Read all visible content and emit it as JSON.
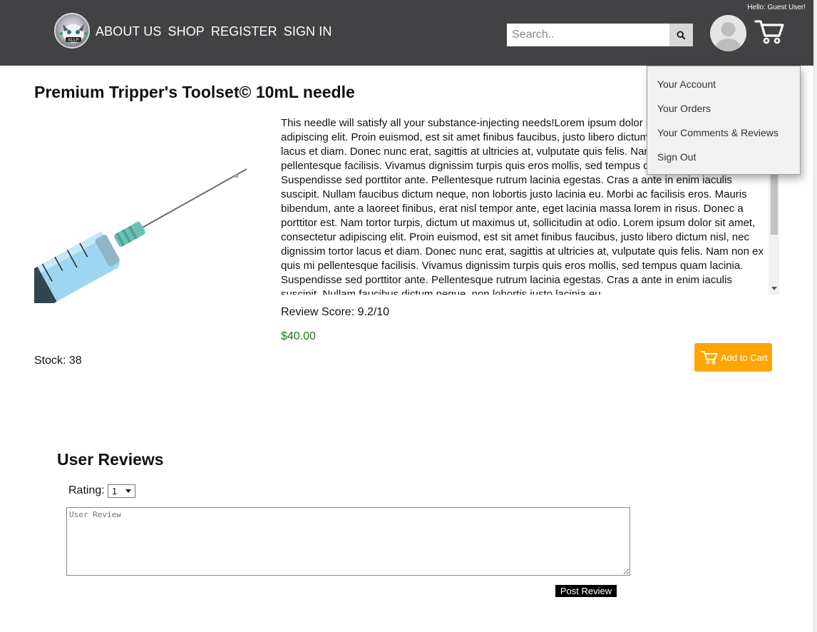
{
  "header": {
    "nav": [
      "ABOUT US",
      "SHOP",
      "REGISTER",
      "SIGN IN"
    ],
    "search_placeholder": "Search..",
    "greeting": "Hello: Guest User!",
    "bg_color": "#424244"
  },
  "user_menu": {
    "items": [
      "Your Account",
      "Your Orders",
      "Your Comments & Reviews",
      "Sign Out"
    ]
  },
  "product": {
    "title": "Premium Tripper's Toolset© 10mL needle",
    "description": "This needle will satisfy all your substance-injecting needs!Lorem ipsum dolor sit amet, consectetur adipiscing elit. Proin euismod, est sit amet finibus faucibus, justo libero dictum nisl, nec dignissim tortor lacus et diam. Donec nunc erat, sagittis at ultricies at, vulputate quis felis. Nam non ex quis mi pellentesque facilisis. Vivamus dignissim turpis quis eros mollis, sed tempus quam lacinia. Suspendisse sed porttitor ante. Pellentesque rutrum lacinia egestas. Cras a ante in enim iaculis suscipit. Nullam faucibus dictum neque, non lobortis justo lacinia eu. Morbi ac facilisis eros. Mauris bibendum, ante a laoreet finibus, erat nisl tempor ante, eget lacinia massa lorem in risus. Donec a porttitor est. Nam tortor turpis, dictum ut maximus ut, sollicitudin at odio. Lorem ipsum dolor sit amet, consectetur adipiscing elit. Proin euismod, est sit amet finibus faucibus, justo libero dictum nisl, nec dignissim tortor lacus et diam. Donec nunc erat, sagittis at ultricies at, vulputate quis felis. Nam non ex quis mi pellentesque facilisis. Vivamus dignissim turpis quis eros mollis, sed tempus quam lacinia. Suspendisse sed porttitor ante. Pellentesque rutrum lacinia egestas. Cras a ante in enim iaculis suscipit. Nullam faucibus dictum neque, non lobortis justo lacinia eu.",
    "review_score": "Review Score: 9.2/10",
    "price": "$40.00",
    "stock": "Stock: 38",
    "add_to_cart": "Add to Cart",
    "price_color": "#1a7a1a",
    "cart_button_color": "#ffa500"
  },
  "reviews": {
    "title": "User Reviews",
    "rating_label": "Rating:",
    "rating_value": "1",
    "review_placeholder": "User Review",
    "post_button": "Post Review"
  }
}
